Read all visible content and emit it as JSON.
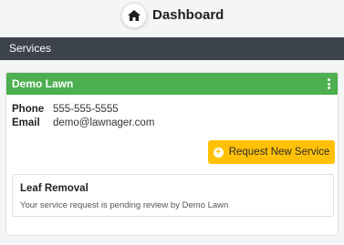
{
  "header": {
    "title": "Dashboard",
    "home_icon": "home-icon"
  },
  "section": {
    "title": "Services"
  },
  "card": {
    "title": "Demo Lawn",
    "header_color": "#4caf50",
    "menu_icon": "kebab-menu-icon",
    "contact": {
      "phone_label": "Phone",
      "phone_value": "555-555-5555",
      "email_label": "Email",
      "email_value": "demo@lawnager.com"
    },
    "request_button": {
      "label": "Request New Service",
      "icon": "plus-circle-icon",
      "color": "#ffc107"
    },
    "service": {
      "title": "Leaf Removal",
      "status": "Your service request is pending review by Demo Lawn"
    }
  }
}
